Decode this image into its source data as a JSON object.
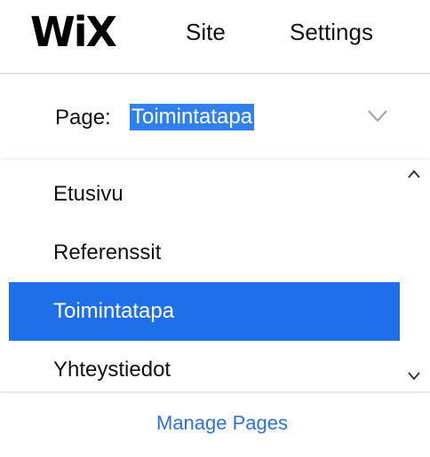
{
  "header": {
    "logo": "WiX",
    "nav": [
      "Site",
      "Settings"
    ]
  },
  "page_selector": {
    "label": "Page:",
    "value": "Toimintatapa",
    "icon": "chevron-down-icon"
  },
  "pages": {
    "items": [
      "Etusivu",
      "Referenssit",
      "Toimintatapa",
      "Yhteystiedot"
    ],
    "selected": "Toimintatapa"
  },
  "footer": {
    "manage_label": "Manage Pages"
  },
  "colors": {
    "accent": "#1f6fe8",
    "link": "#2f6fe0",
    "divider": "#e6e9ef"
  }
}
